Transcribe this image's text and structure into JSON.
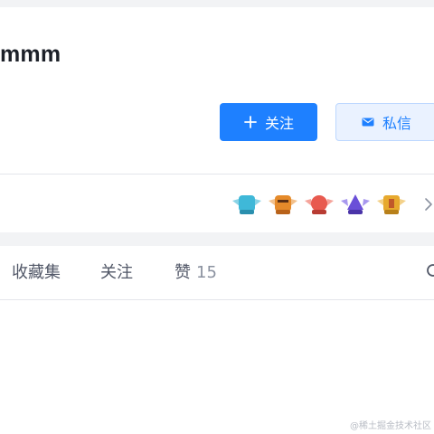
{
  "profile": {
    "username": "mmm",
    "follow_label": "关注",
    "message_label": "私信"
  },
  "badges": [
    {
      "name": "badge-1",
      "color": "#3fb8d8"
    },
    {
      "name": "badge-2",
      "color": "#e58a2a"
    },
    {
      "name": "badge-3",
      "color": "#e85a4f"
    },
    {
      "name": "badge-4",
      "color": "#6a4fd8"
    },
    {
      "name": "badge-5",
      "color": "#e7a92e"
    }
  ],
  "tabs": [
    {
      "label": "收藏集",
      "count": ""
    },
    {
      "label": "关注",
      "count": ""
    },
    {
      "label": "赞",
      "count": "15"
    }
  ],
  "watermark": "@稀土掘金技术社区",
  "colors": {
    "accent": "#1e80ff",
    "background": "#f2f3f5",
    "text": "#1d2129",
    "muted": "#8a919f"
  }
}
